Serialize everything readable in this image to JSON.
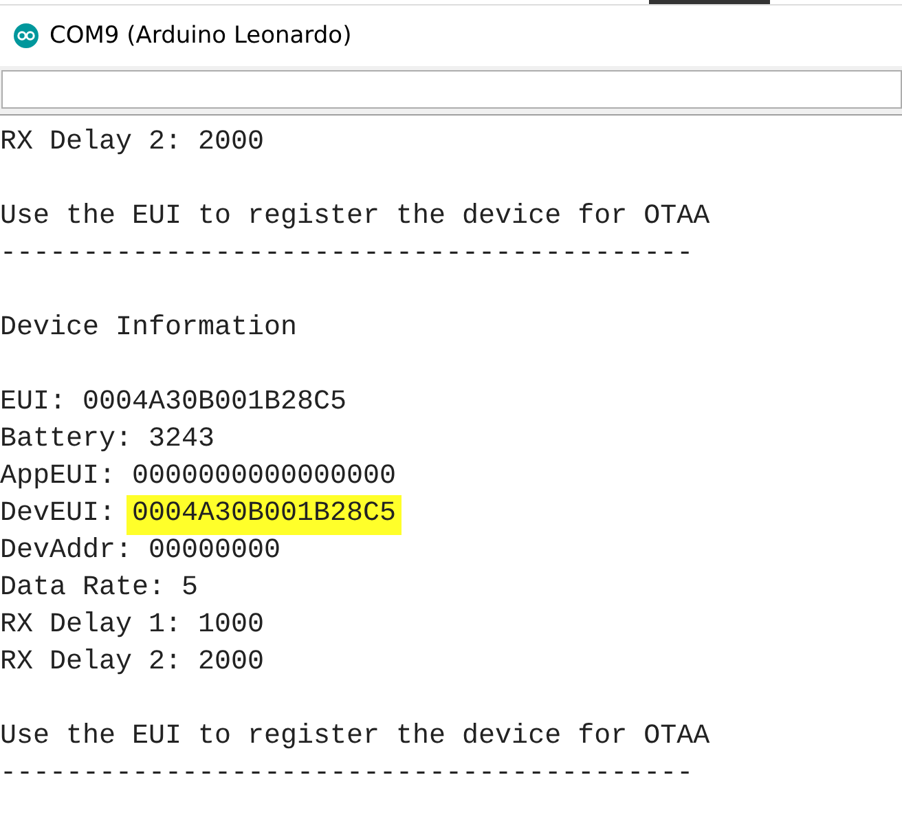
{
  "window": {
    "title": "COM9 (Arduino Leonardo)"
  },
  "output": [
    {
      "kind": "text",
      "text": "RX Delay 2: 2000"
    },
    {
      "kind": "blank"
    },
    {
      "kind": "text",
      "text": "Use the EUI to register the device for OTAA"
    },
    {
      "kind": "text",
      "text": "------------------------------------------"
    },
    {
      "kind": "blank"
    },
    {
      "kind": "text",
      "text": "Device Information"
    },
    {
      "kind": "blank"
    },
    {
      "kind": "text",
      "text": "EUI: 0004A30B001B28C5"
    },
    {
      "kind": "text",
      "text": "Battery: 3243"
    },
    {
      "kind": "text",
      "text": "AppEUI: 0000000000000000"
    },
    {
      "kind": "pair",
      "text": "DevEUI:",
      "value": "0004A30B001B28C5",
      "highlighted": true
    },
    {
      "kind": "text",
      "text": "DevAddr: 00000000"
    },
    {
      "kind": "text",
      "text": "Data Rate: 5"
    },
    {
      "kind": "text",
      "text": "RX Delay 1: 1000"
    },
    {
      "kind": "text",
      "text": "RX Delay 2: 2000"
    },
    {
      "kind": "blank"
    },
    {
      "kind": "text",
      "text": "Use the EUI to register the device for OTAA"
    },
    {
      "kind": "text",
      "text": "------------------------------------------"
    }
  ]
}
